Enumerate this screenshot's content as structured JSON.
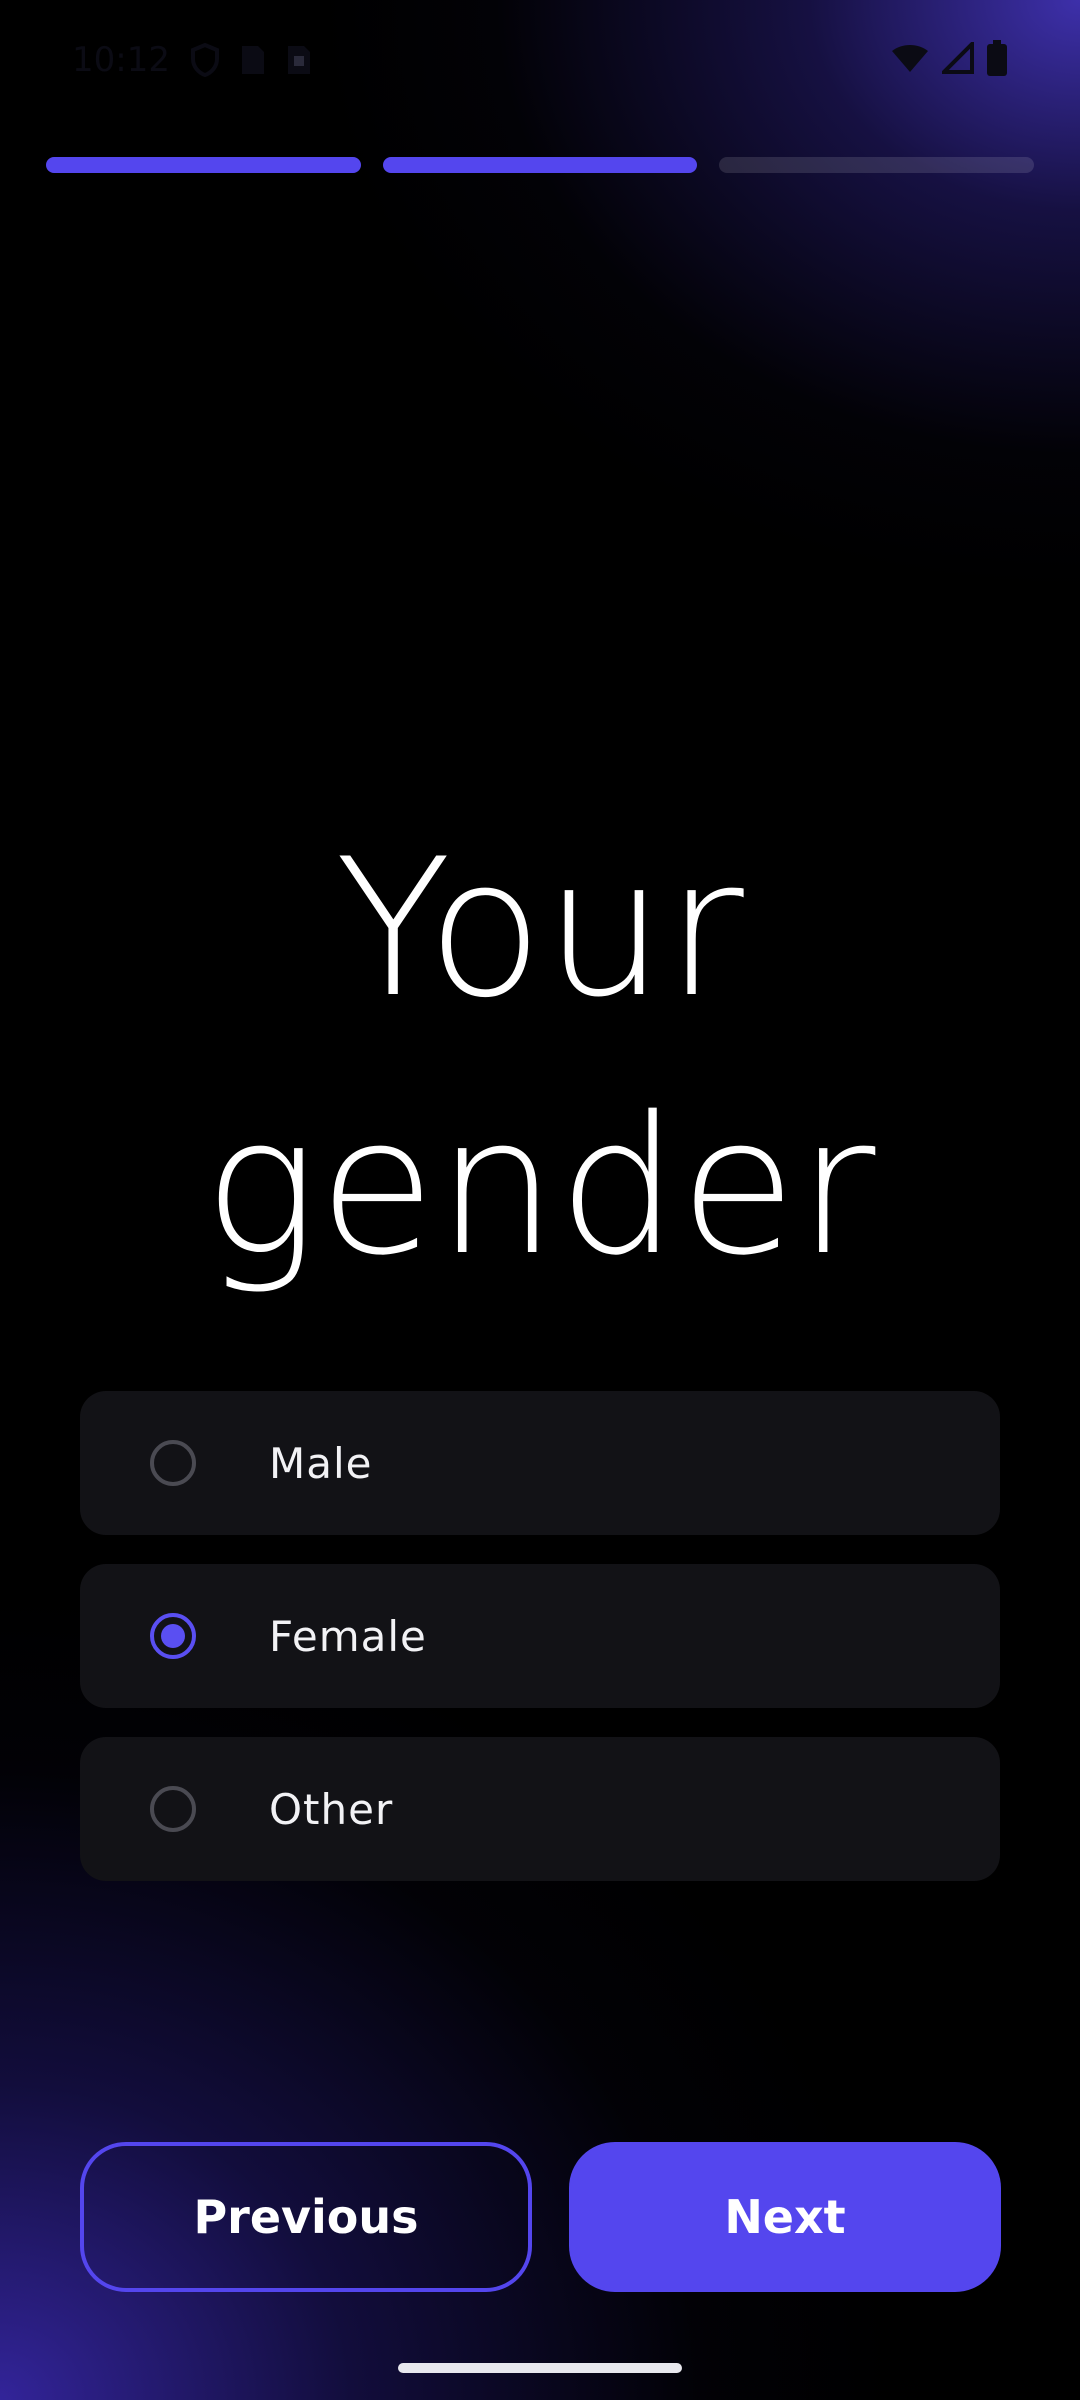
{
  "status_bar": {
    "time": "10:12",
    "left_icons": [
      "shield-icon",
      "sim-card-icon",
      "sd-card-icon"
    ],
    "right_icons": [
      "wifi-icon",
      "cellular-signal-icon",
      "battery-icon"
    ]
  },
  "progress": {
    "total_steps": 3,
    "completed_steps": 2,
    "active_color": "#5446ee"
  },
  "title": {
    "line1": "Your",
    "line2": "gender"
  },
  "options": [
    {
      "label": "Male",
      "selected": false
    },
    {
      "label": "Female",
      "selected": true
    },
    {
      "label": "Other",
      "selected": false
    }
  ],
  "buttons": {
    "previous_label": "Previous",
    "next_label": "Next"
  },
  "colors": {
    "accent": "#5446ee",
    "card_background": "#121216",
    "page_background": "#000000"
  }
}
